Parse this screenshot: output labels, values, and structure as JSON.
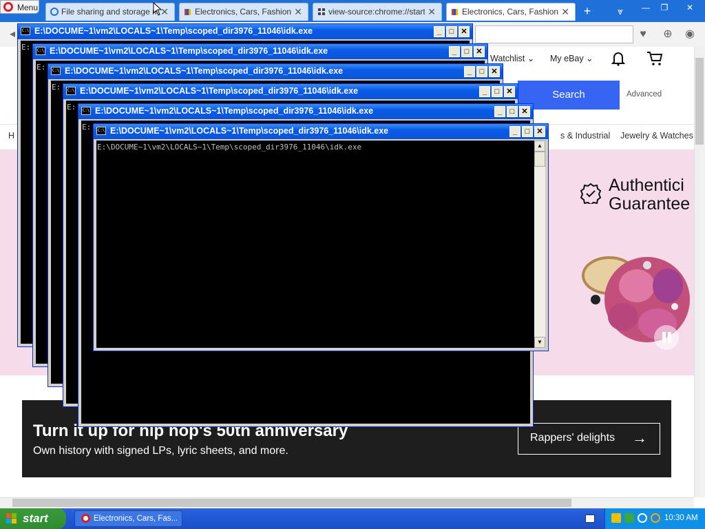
{
  "browser": {
    "menu_label": "Menu",
    "tabs": [
      {
        "label": "File sharing and storage ma..."
      },
      {
        "label": "Electronics, Cars, Fashion, C"
      },
      {
        "label": "view-source:chrome://startp"
      },
      {
        "label": "Electronics, Cars, Fashion, C"
      }
    ],
    "new_tab": "+",
    "tab_menu": "⩔",
    "window_controls": {
      "minimize": "—",
      "maximize": "❐",
      "close": "✕"
    }
  },
  "ebay": {
    "nav": {
      "watchlist": "Watchlist",
      "my_ebay": "My eBay"
    },
    "search_button": "Search",
    "advanced_link": "Advanced",
    "categories": [
      "H",
      "s & Industrial",
      "Jewelry & Watches"
    ],
    "hero": {
      "line1": "Authentici",
      "line2": "Guarantee"
    },
    "promo": {
      "title": "Turn it up for hip hop's 50th anniversary",
      "subtitle": "Own history with signed LPs, lyric sheets, and more.",
      "button": "Rappers' delights"
    }
  },
  "console": {
    "title": "E:\\DOCUME~1\\vm2\\LOCALS~1\\Temp\\scoped_dir3976_11046\\idk.exe",
    "output": "E:\\DOCUME~1\\vm2\\LOCALS~1\\Temp\\scoped_dir3976_11046\\idk.exe",
    "partial": "E:",
    "icon_text": "C:\\"
  },
  "taskbar": {
    "start": "start",
    "task": "Electronics, Cars, Fas...",
    "clock": "10:30 AM"
  },
  "colors": {
    "tabbar": "#1f70d9",
    "ebay_blue": "#3665f3",
    "hero_pink": "#f6dcea",
    "promo_bg": "#1e1e1e",
    "xp_taskbar": "#245edb"
  }
}
